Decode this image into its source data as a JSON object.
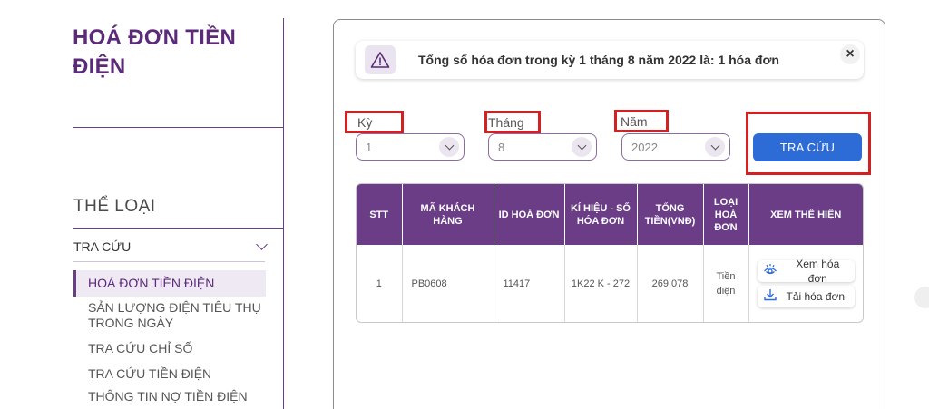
{
  "sidebar": {
    "page_title": "HOÁ ĐƠN TIỀN ĐIỆN",
    "category_title": "THỂ LOẠI",
    "group_label": "TRA CỨU",
    "items": [
      {
        "label": "HOÁ ĐƠN TIỀN ĐIỆN"
      },
      {
        "label": "SẢN LƯỢNG ĐIỆN TIÊU THỤ TRONG NGÀY"
      },
      {
        "label": "TRA CỨU CHỈ SỐ"
      },
      {
        "label": "TRA CỨU TIỀN ĐIỆN"
      },
      {
        "label": "THÔNG TIN NỢ TIỀN ĐIỆN"
      }
    ]
  },
  "alert": {
    "message": "Tổng số hóa đơn trong kỳ 1 tháng 8 năm 2022 là: 1 hóa đơn",
    "close_label": "×"
  },
  "filters": {
    "ky": {
      "label": "Kỳ",
      "value": "1"
    },
    "thang": {
      "label": "Tháng",
      "value": "8"
    },
    "nam": {
      "label": "Năm",
      "value": "2022"
    },
    "search_label": "TRA CỨU"
  },
  "table": {
    "headers": [
      "STT",
      "MÃ KHÁCH HÀNG",
      "ID HOÁ ĐƠN",
      "KÍ HIỆU - SỐ HÓA ĐƠN",
      "TỔNG TIỀN(VNĐ)",
      "LOẠI HOÁ ĐƠN",
      "XEM THỂ HIỆN"
    ],
    "rows": [
      {
        "stt": "1",
        "ma_khach_hang": "PB0608",
        "id_hoa_don": "11417",
        "ki_hieu": "1K22     K - 272",
        "tong_tien": "269.078",
        "loai": "Tiền điện",
        "view_label": "Xem hóa đơn",
        "download_label": "Tải hóa đơn"
      }
    ]
  },
  "colors": {
    "brand_purple": "#6a3d86",
    "primary_blue": "#2d6bd6",
    "highlight_red": "#d32020"
  },
  "icons": [
    "alert-triangle-icon",
    "close-icon",
    "chevron-down-icon",
    "eye-icon",
    "download-icon"
  ]
}
